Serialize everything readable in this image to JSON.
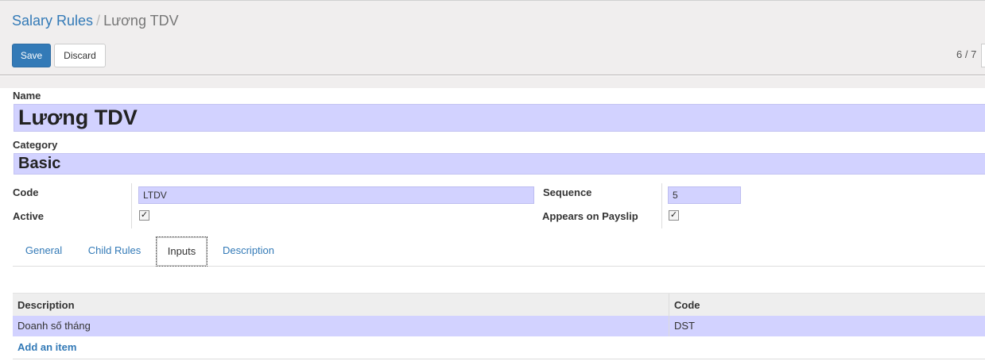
{
  "breadcrumb": {
    "parent": "Salary Rules",
    "separator": "/",
    "current": "Lương TDV"
  },
  "toolbar": {
    "save_label": "Save",
    "discard_label": "Discard"
  },
  "pager": {
    "value": "6 / 7"
  },
  "form": {
    "name_label": "Name",
    "name_value": "Lương TDV",
    "category_label": "Category",
    "category_value": "Basic",
    "code_label": "Code",
    "code_value": "LTDV",
    "active_label": "Active",
    "active_checked": true,
    "sequence_label": "Sequence",
    "sequence_value": "5",
    "appears_label": "Appears on Payslip",
    "appears_checked": true,
    "check_glyph": "✓"
  },
  "tabs": [
    {
      "label": "General",
      "active": false
    },
    {
      "label": "Child Rules",
      "active": false
    },
    {
      "label": "Inputs",
      "active": true
    },
    {
      "label": "Description",
      "active": false
    }
  ],
  "inputs_table": {
    "columns": [
      "Description",
      "Code"
    ],
    "rows": [
      {
        "description": "Doanh số tháng",
        "code": "DST"
      }
    ],
    "add_item_label": "Add an item"
  },
  "colors": {
    "link": "#337ab7",
    "primary_button": "#337ab7",
    "required_field": "#d2d2ff",
    "panel_bg": "#f0eeee"
  }
}
